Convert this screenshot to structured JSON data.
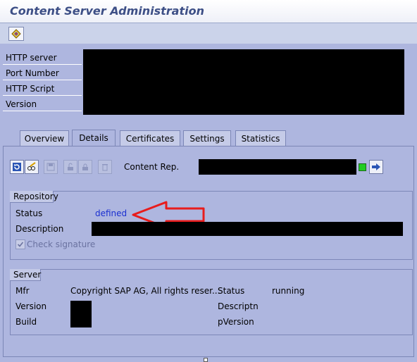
{
  "window": {
    "title": "Content Server Administration"
  },
  "toolbar": {
    "icon": "display-change-icon"
  },
  "header_fields": {
    "labels": [
      "HTTP server",
      "Port Number",
      "HTTP Script",
      "Version"
    ]
  },
  "tabs": [
    {
      "label": "Overview"
    },
    {
      "label": "Details"
    },
    {
      "label": "Certificates"
    },
    {
      "label": "Settings"
    },
    {
      "label": "Statistics"
    }
  ],
  "active_tab": "Details",
  "details": {
    "content_rep_label": "Content Rep.",
    "status_light_color": "#22cc22",
    "repository": {
      "title": "Repository",
      "status_label": "Status",
      "status_value": "defined",
      "description_label": "Description",
      "check_signature_label": "Check signature",
      "check_signature_checked": true
    },
    "server": {
      "title": "Server",
      "mfr_label": "Mfr",
      "mfr_value": "Copyright SAP AG, All rights reser...",
      "version_label": "Version",
      "build_label": "Build",
      "status_label": "Status",
      "status_value": "running",
      "descriptn_label": "Descriptn",
      "pversion_label": "pVersion"
    }
  },
  "colors": {
    "background": "#aeb6df",
    "title_text": "#3d4f86",
    "link": "#1a2fd0",
    "annotation_arrow": "#e81c1c"
  }
}
